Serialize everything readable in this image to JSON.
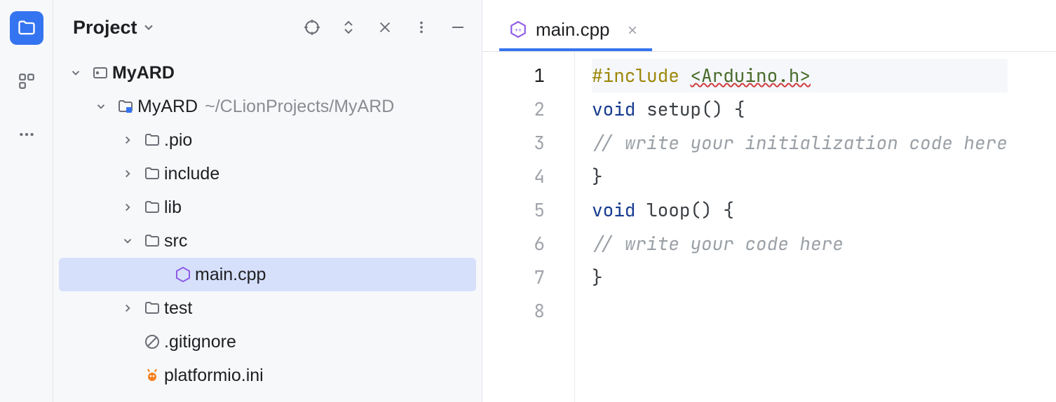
{
  "panel": {
    "title": "Project"
  },
  "tree": {
    "root": {
      "name": "MyARD",
      "child": {
        "name": "MyARD",
        "path": "~/CLionProjects/MyARD",
        "items": [
          {
            "name": ".pio",
            "kind": "dir",
            "expandable": true
          },
          {
            "name": "include",
            "kind": "dir",
            "expandable": true
          },
          {
            "name": "lib",
            "kind": "dir",
            "expandable": true
          },
          {
            "name": "src",
            "kind": "dir-open",
            "children": [
              {
                "name": "main.cpp",
                "kind": "cpp",
                "selected": true
              }
            ]
          },
          {
            "name": "test",
            "kind": "dir",
            "expandable": true
          },
          {
            "name": ".gitignore",
            "kind": "ignore"
          },
          {
            "name": "platformio.ini",
            "kind": "pio"
          }
        ]
      }
    }
  },
  "tab": {
    "file": "main.cpp"
  },
  "code": {
    "lines": [
      {
        "n": 1,
        "tokens": [
          {
            "t": "#include ",
            "c": "pp"
          },
          {
            "t": "<Arduino.h>",
            "c": "inc"
          }
        ],
        "current": true
      },
      {
        "n": 2,
        "tokens": [
          {
            "t": "void ",
            "c": "kw"
          },
          {
            "t": "setup",
            "c": "fn"
          },
          {
            "t": "() {",
            "c": "op"
          }
        ]
      },
      {
        "n": 3,
        "tokens": [
          {
            "t": "// write your initialization code here",
            "c": "cm"
          }
        ]
      },
      {
        "n": 4,
        "tokens": [
          {
            "t": "}",
            "c": "op"
          }
        ]
      },
      {
        "n": 5,
        "tokens": [
          {
            "t": "",
            "c": "op"
          }
        ]
      },
      {
        "n": 6,
        "tokens": [
          {
            "t": "void ",
            "c": "kw"
          },
          {
            "t": "loop",
            "c": "fn"
          },
          {
            "t": "() {",
            "c": "op"
          }
        ]
      },
      {
        "n": 7,
        "tokens": [
          {
            "t": "// write your code here",
            "c": "cm"
          }
        ]
      },
      {
        "n": 8,
        "tokens": [
          {
            "t": "}",
            "c": "op"
          }
        ]
      }
    ]
  }
}
